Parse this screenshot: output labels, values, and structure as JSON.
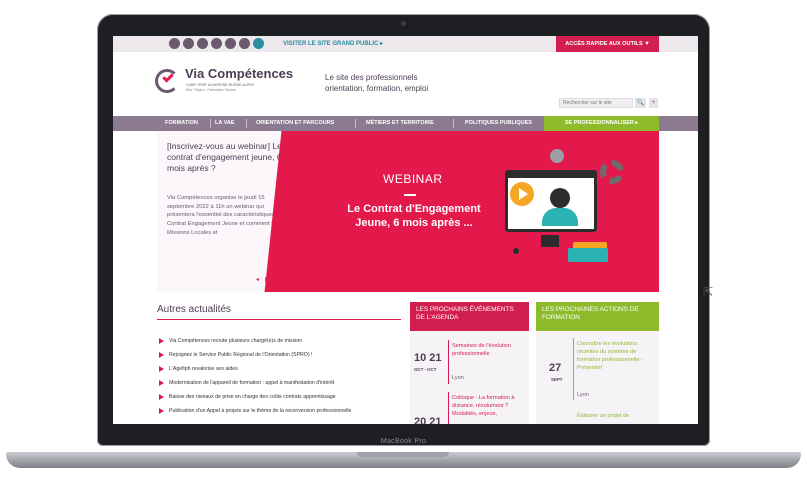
{
  "device": {
    "label": "MacBook Pro"
  },
  "topbar": {
    "social_icons": [
      "user-icon",
      "linkedin-icon",
      "twitter-icon",
      "youtube-icon",
      "rss-icon",
      "mail-icon",
      "globe-icon"
    ],
    "visit_link": "VISITER LE SITE GRAND PUBLIC ▸",
    "quick_access": "ACCÈS RAPIDE AUX OUTILS ▼"
  },
  "header": {
    "logo_title": "Via Compétences",
    "logo_sub": "CARIF OREF AUVERGNE-RHÔNE-ALPES",
    "logo_sub2": "État · Région · Partenaires Sociaux",
    "tagline": "Le site des professionnels orientation, formation, emploi",
    "search_placeholder": "Rechercher sur le site",
    "search_button": "🔍",
    "plus_button": "+"
  },
  "nav": {
    "items": [
      "FORMATION",
      "LA VAE",
      "ORIENTATION ET PARCOURS",
      "MÉTIERS ET TERRITOIRE",
      "POLITIQUES PUBLIQUES"
    ],
    "cta": "SE PROFESSIONNALISER ▸"
  },
  "hero": {
    "title": "[Inscrivez-vous au webinar] Le contrat d'engagement jeune, 6 mois après ?",
    "text": "Via Compétences organise le jeudi 15 septembre 2022 à 11h un webinar qui présentera l'essentiel des caractéristiques du Contrat Engagement Jeune et comment les Missions Locales et",
    "controls": "◂ ▮▮ ▸",
    "banner_kicker": "WEBINAR",
    "banner_title": "Le Contrat d'Engagement Jeune, 6 mois après ..."
  },
  "news": {
    "title": "Autres actualités",
    "items": [
      "Via Compétences recrute plusieurs chargé(e)s de mission",
      "Rejoignez le Service Public Régional de l'Orientation (SPRO) !",
      "L'Agefiph revalorise ses aides",
      "Modernisation de l'appareil de formation : appel à manifestation d'intérêt",
      "Baisse des niveaux de prise en charge des coûts contrats apprentissage",
      "Publication d'un Appel à projets sur le thème de la reconversion professionnelle"
    ]
  },
  "events": {
    "heading": "LES PROCHAINS ÉVÉNEMENTS DE L'AGENDA",
    "items": [
      {
        "date": "10 21",
        "month": "OCT - OCT",
        "title": "Semaines de l'évolution professionnelle",
        "place": "Lyon"
      },
      {
        "date": "20 21",
        "title": "Colloque : La formation à distance, résolument ? Modalités, enjeux,"
      }
    ]
  },
  "actions": {
    "heading": "LES PROCHAINES ACTIONS DE FORMATION",
    "items": [
      {
        "date": "27",
        "month": "SEPT",
        "title": "Connaître les évolutions récentes du système de formation professionnelle - Présentiel",
        "place": "Lyon"
      },
      {
        "title": "Élaborer un projet de"
      }
    ]
  }
}
